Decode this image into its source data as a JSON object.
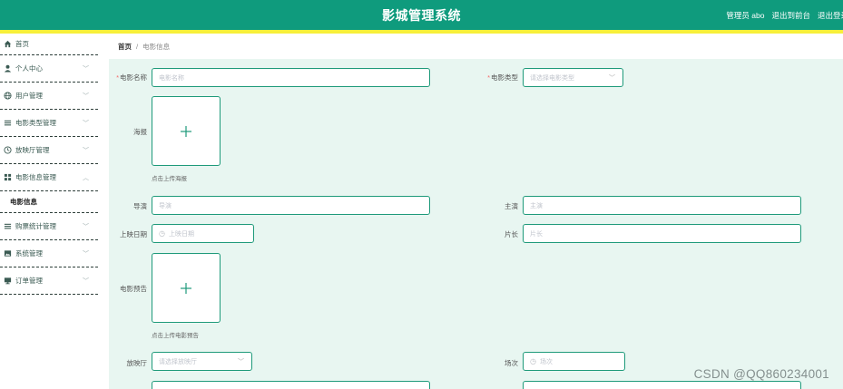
{
  "header": {
    "title": "影城管理系统",
    "user_label": "管理员 abo",
    "exit_frontend": "退出到前台",
    "logout": "退出登录"
  },
  "sidebar": {
    "home": "首页",
    "items": [
      {
        "label": "个人中心",
        "icon": "user-icon"
      },
      {
        "label": "用户管理",
        "icon": "globe-icon"
      },
      {
        "label": "电影类型管理",
        "icon": "list-icon"
      },
      {
        "label": "放映厅管理",
        "icon": "clock-icon"
      },
      {
        "label": "电影信息管理",
        "icon": "grid-icon"
      },
      {
        "label": "购票统计管理",
        "icon": "list-icon"
      },
      {
        "label": "系统管理",
        "icon": "image-icon"
      },
      {
        "label": "订单管理",
        "icon": "monitor-icon"
      }
    ],
    "sub_item": "电影信息"
  },
  "breadcrumb": {
    "home": "首页",
    "separator": "/",
    "current": "电影信息"
  },
  "form": {
    "movie_name": {
      "label": "电影名称",
      "placeholder": "电影名称"
    },
    "movie_type": {
      "label": "电影类型",
      "placeholder": "请选择电影类型"
    },
    "poster": {
      "label": "海报",
      "hint": "点击上传海报"
    },
    "director": {
      "label": "导演",
      "placeholder": "导演"
    },
    "cast": {
      "label": "主演",
      "placeholder": "主演"
    },
    "release_date": {
      "label": "上映日期",
      "placeholder": "上映日期"
    },
    "duration": {
      "label": "片长",
      "placeholder": "片长"
    },
    "trailer": {
      "label": "电影预告",
      "hint": "点击上传电影预告"
    },
    "hall": {
      "label": "放映厅",
      "placeholder": "请选择放映厅"
    },
    "session": {
      "label": "场次",
      "placeholder": "场次"
    }
  },
  "watermark": "CSDN @QQ860234001",
  "colors": {
    "primary": "#0f9b7d",
    "accent_strip": "#f7f03a",
    "form_bg": "#e8f6f1",
    "required": "#f56c6c"
  }
}
